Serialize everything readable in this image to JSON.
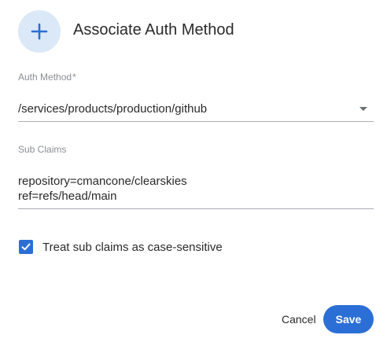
{
  "dialog": {
    "title": "Associate Auth Method",
    "header_icon": "plus-icon",
    "accent_color": "#2b6fd6",
    "icon_background": "#dbe8f7"
  },
  "auth_method": {
    "label": "Auth Method",
    "required_marker": "*",
    "value": "/services/products/production/github"
  },
  "sub_claims": {
    "label": "Sub Claims",
    "value": "repository=cmancone/clearskies\nref=refs/head/main"
  },
  "case_sensitive": {
    "label": "Treat sub claims as case-sensitive",
    "checked": true
  },
  "actions": {
    "cancel_label": "Cancel",
    "save_label": "Save"
  }
}
